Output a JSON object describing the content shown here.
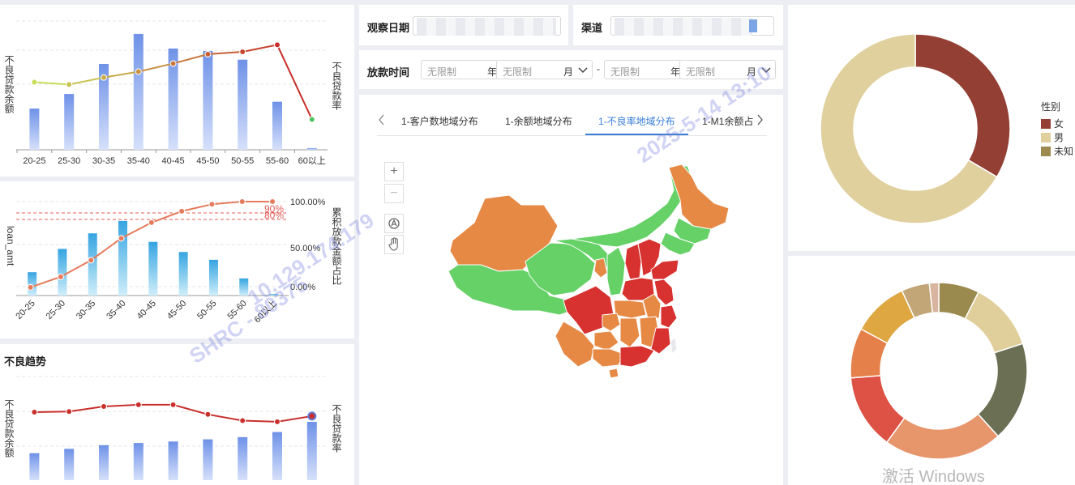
{
  "chart1": {
    "left_axis_label": "不良贷款余额",
    "right_axis_label": "不良贷款率",
    "chart_data": {
      "type": "bar",
      "categories": [
        "20-25",
        "25-30",
        "30-35",
        "35-40",
        "40-45",
        "45-50",
        "50-55",
        "55-60",
        "60以上"
      ],
      "series": [
        {
          "values": [
            48,
            65,
            100,
            135,
            118,
            115,
            105,
            56,
            2
          ]
        },
        {
          "values": [
            0.58,
            0.56,
            0.62,
            0.67,
            0.74,
            0.82,
            0.84,
            0.9,
            0.26
          ]
        }
      ]
    }
  },
  "chart2": {
    "left_axis_label": "loan_amt",
    "right_axis_label": "累积放款金额占比",
    "right_ticks": [
      "100.00%",
      "50.00%",
      "0.00%"
    ],
    "ref_lines": [
      "90%",
      "80%"
    ],
    "chart_data": {
      "type": "bar",
      "categories": [
        "20-25",
        "25-30",
        "30-35",
        "35-40",
        "40-45",
        "45-50",
        "50-55",
        "55-60",
        "60以上"
      ],
      "series": [
        {
          "values": [
            30,
            60,
            80,
            96,
            69,
            56,
            46,
            22,
            2
          ]
        },
        {
          "values": [
            0.02,
            0.14,
            0.33,
            0.58,
            0.76,
            0.89,
            0.97,
            1.0,
            1.0
          ]
        }
      ],
      "y2lim": [
        0,
        1
      ]
    }
  },
  "chart3": {
    "title": "不良趋势",
    "left_axis_label": "不良贷款余额",
    "right_axis_label": "不良贷款率",
    "chart_data": {
      "type": "bar",
      "series": [
        {
          "values": [
            37,
            43,
            48,
            51,
            53,
            56,
            59,
            66,
            80
          ]
        },
        {
          "values": [
            0.8,
            0.81,
            0.9,
            0.93,
            0.93,
            0.76,
            0.65,
            0.63,
            0.73
          ]
        }
      ]
    }
  },
  "filters": {
    "obs_date_label": "观察日期",
    "channel_label": "渠道",
    "loan_time_label": "放款时间",
    "range_separator": "-",
    "from": {
      "start_placeholder": "无限制",
      "start_unit": "年",
      "end_placeholder": "无限制",
      "end_unit": "月"
    },
    "to": {
      "start_placeholder": "无限制",
      "start_unit": "年",
      "end_placeholder": "无限制",
      "end_unit": "月"
    }
  },
  "tabs": {
    "items": [
      "1-客户数地域分布",
      "1-余额地域分布",
      "1-不良率地域分布",
      "1-M1余额占"
    ],
    "active": 2
  },
  "map": {
    "region_colors": {
      "high": "#d7322f",
      "mid": "#e68945",
      "low": "#66d167"
    }
  },
  "donut_gender": {
    "legend_title": "性别",
    "chart_data": {
      "type": "pie",
      "categories": [
        "女",
        "男",
        "未知"
      ],
      "values": [
        0.335,
        0.665,
        0.0
      ],
      "colors": [
        "#943f34",
        "#e0d09e",
        "#9c8a4f"
      ]
    }
  },
  "donut_2": {
    "chart_data": {
      "type": "pie",
      "values": [
        6.5,
        11,
        16,
        19,
        12,
        8,
        9,
        4.5,
        1.5
      ],
      "colors": [
        "#9a8a4e",
        "#e0cf9a",
        "#6b6f54",
        "#e7956b",
        "#dd5245",
        "#e6804a",
        "#dfa741",
        "#c2a677",
        "#d9b59f"
      ]
    }
  },
  "os_watermark": "激活 Windows",
  "overlay_watermark": {
    "line1": "SHRC - 80375",
    "line2": "10.129.174.179",
    "line3": "2025-5-14 13:10"
  }
}
